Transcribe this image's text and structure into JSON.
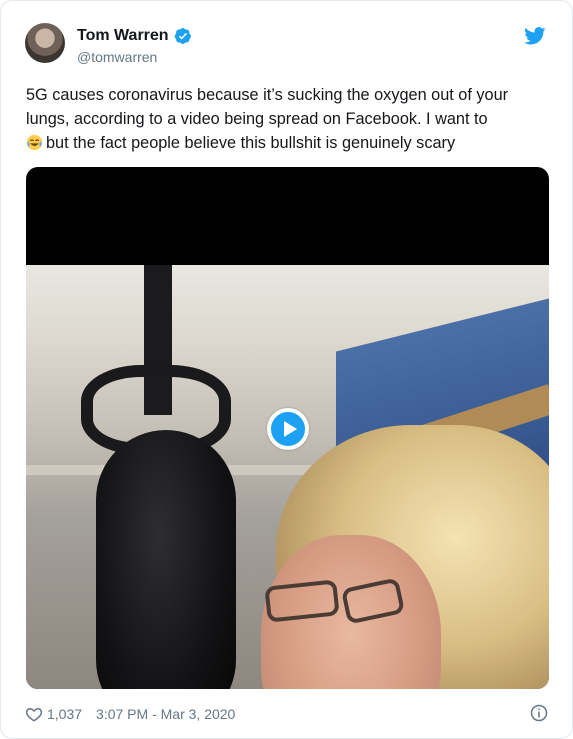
{
  "author": {
    "display_name": "Tom Warren",
    "handle": "@tomwarren",
    "verified": true
  },
  "tweet": {
    "line1": "5G causes coronavirus because it’s sucking the oxygen out of your lungs, according to a video being spread on Facebook. I want to",
    "line2": "but the fact people believe this bullshit is genuinely scary",
    "emoji": "face-with-tears-of-joy"
  },
  "media": {
    "type": "video",
    "play_icon": "play-icon"
  },
  "footer": {
    "like_count": "1,037",
    "timestamp": "3:07 PM - Mar 3, 2020"
  },
  "icons": {
    "verified": "verified-badge-icon",
    "brand": "twitter-bird-icon",
    "like": "heart-icon",
    "info": "info-icon"
  },
  "colors": {
    "brand_blue": "#1da1f2",
    "text": "#14171a",
    "muted": "#657786",
    "border": "#e1e8ed"
  }
}
